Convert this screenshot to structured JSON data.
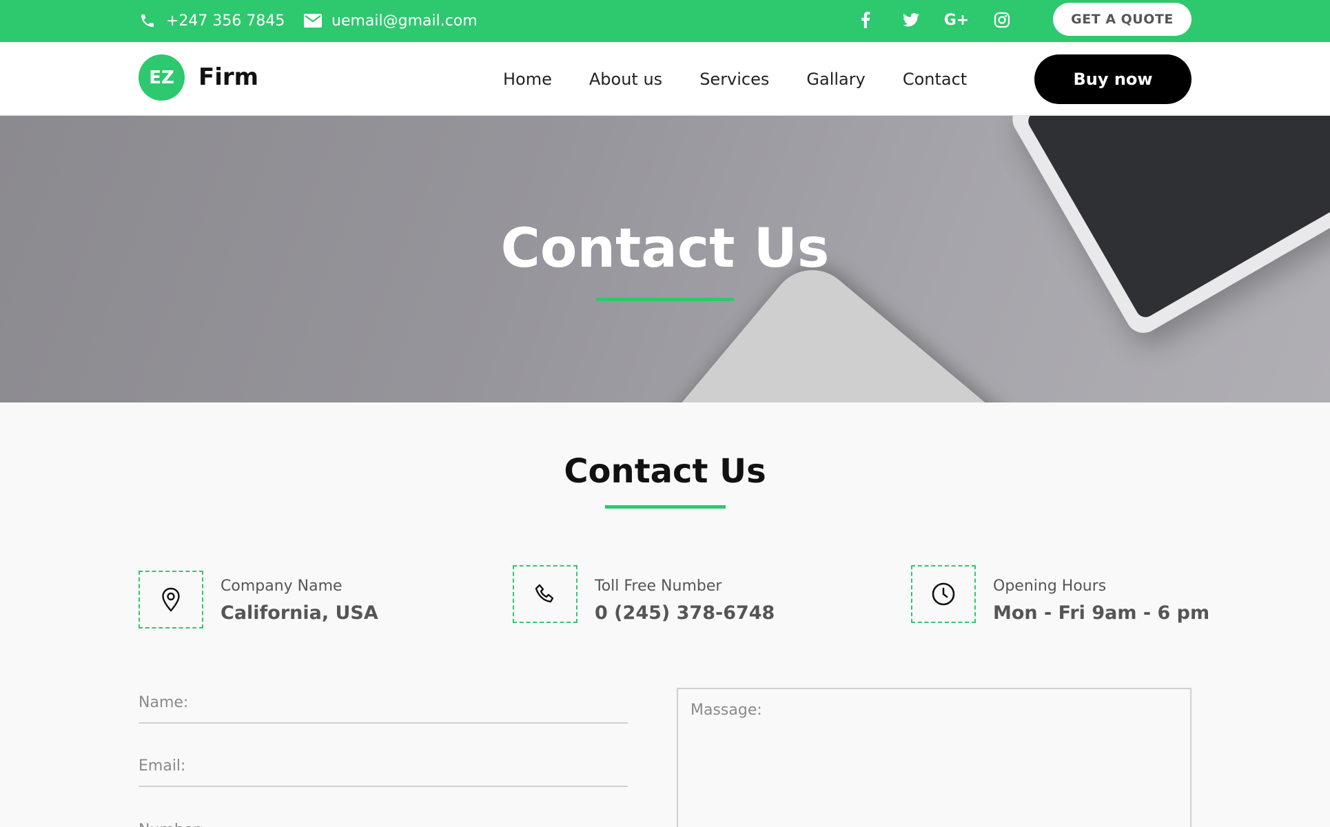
{
  "topbar": {
    "phone": "+247 356 7845",
    "email": "uemail@gmail.com",
    "socials": [
      {
        "icon": "facebook-icon"
      },
      {
        "icon": "twitter-icon"
      },
      {
        "icon": "google-plus-icon",
        "glyph": "G+"
      },
      {
        "icon": "instagram-icon"
      }
    ],
    "quote_label": "GET A QUOTE",
    "background_color": "#2ec86e"
  },
  "header": {
    "logo_badge": "EZ",
    "logo_text": "Firm",
    "nav": [
      "Home",
      "About us",
      "Services",
      "Gallary",
      "Contact"
    ],
    "buy_label": "Buy now"
  },
  "hero": {
    "title": "Contact Us"
  },
  "contact": {
    "title": "Contact Us",
    "info": [
      {
        "icon": "location-pin-icon",
        "label": "Company Name",
        "value": "California, USA"
      },
      {
        "icon": "phone-icon",
        "label": "Toll Free Number",
        "value": "0 (245) 378-6748"
      },
      {
        "icon": "clock-icon",
        "label": "Opening Hours",
        "value": "Mon - Fri 9am - 6 pm"
      }
    ],
    "form": {
      "name_placeholder": "Name:",
      "email_placeholder": "Email:",
      "third_placeholder": "Number:",
      "message_placeholder": "Massage:"
    }
  },
  "colors": {
    "accent": "#2ec86e",
    "dark_button": "#000000"
  }
}
